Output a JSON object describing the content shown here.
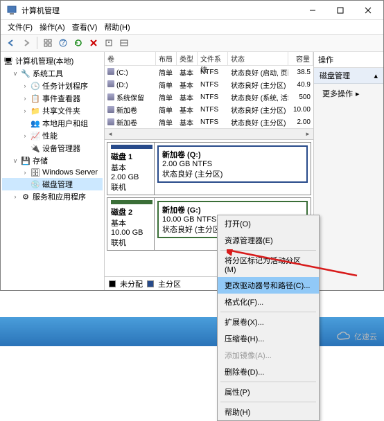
{
  "titlebar": {
    "title": "计算机管理"
  },
  "menus": [
    "文件(F)",
    "操作(A)",
    "查看(V)",
    "帮助(H)"
  ],
  "tree": {
    "root": "计算机管理(本地)",
    "sys": {
      "label": "系统工具",
      "items": [
        "任务计划程序",
        "事件查看器",
        "共享文件夹",
        "本地用户和组",
        "性能",
        "设备管理器"
      ]
    },
    "storage": {
      "label": "存储",
      "ws": "Windows Server",
      "disk": "磁盘管理"
    },
    "svc": "服务和应用程序"
  },
  "list": {
    "headers": [
      "卷",
      "布局",
      "类型",
      "文件系统",
      "状态",
      "容量"
    ],
    "rows": [
      {
        "vol": "(C:)",
        "layout": "简单",
        "type": "基本",
        "fs": "NTFS",
        "status": "状态良好 (启动, 页面文件, 故障转储, 主分区)",
        "cap": "38.5"
      },
      {
        "vol": "(D:)",
        "layout": "简单",
        "type": "基本",
        "fs": "NTFS",
        "status": "状态良好 (主分区)",
        "cap": "40.9"
      },
      {
        "vol": "系统保留",
        "layout": "简单",
        "type": "基本",
        "fs": "NTFS",
        "status": "状态良好 (系统, 活动, 主分区)",
        "cap": "500"
      },
      {
        "vol": "新加卷",
        "layout": "简单",
        "type": "基本",
        "fs": "NTFS",
        "status": "状态良好 (主分区)",
        "cap": "10.00"
      },
      {
        "vol": "新加卷",
        "layout": "简单",
        "type": "基本",
        "fs": "NTFS",
        "status": "状态良好 (主分区)",
        "cap": "2.00"
      }
    ]
  },
  "disks": [
    {
      "name": "磁盘 1",
      "type": "基本",
      "size": "2.00 GB",
      "state": "联机",
      "part": {
        "label": "新加卷  (Q:)",
        "size": "2.00 GB NTFS",
        "status": "状态良好 (主分区)"
      }
    },
    {
      "name": "磁盘 2",
      "type": "基本",
      "size": "10.00 GB",
      "state": "联机",
      "part": {
        "label": "新加卷  (G:)",
        "size": "10.00 GB NTFS",
        "status": "状态良好 (主分区)"
      }
    }
  ],
  "legend": {
    "unalloc": "未分配",
    "primary": "主分区"
  },
  "actions": {
    "header": "操作",
    "section": "磁盘管理",
    "more": "更多操作"
  },
  "context": [
    "打开(O)",
    "资源管理器(E)",
    "-",
    "将分区标记为活动分区(M)",
    "更改驱动器号和路径(C)...",
    "格式化(F)...",
    "-",
    "扩展卷(X)...",
    "压缩卷(H)...",
    "添加镜像(A)...",
    "删除卷(D)...",
    "-",
    "属性(P)",
    "-",
    "帮助(H)"
  ],
  "watermark": "亿速云"
}
